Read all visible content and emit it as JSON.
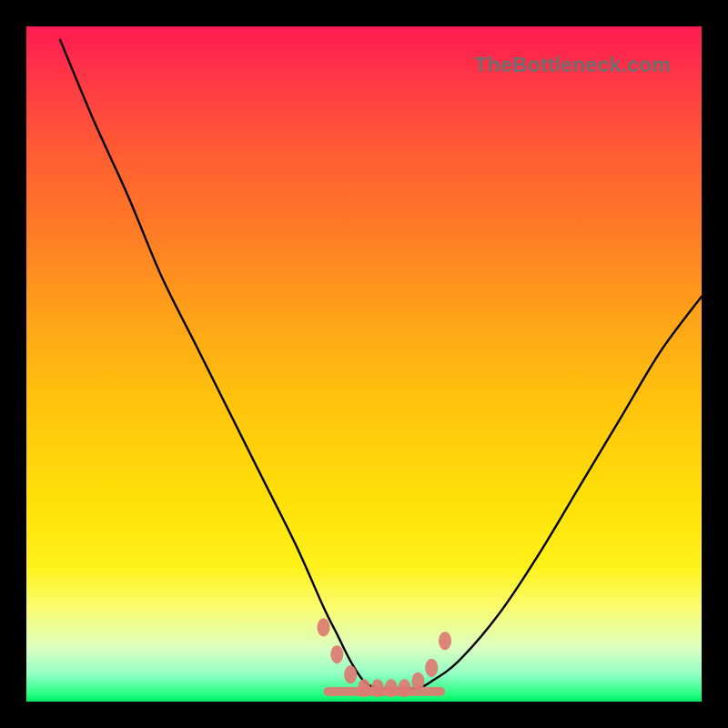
{
  "watermark": "TheBottleneck.com",
  "colors": {
    "frame": "#000000",
    "curve": "#000000",
    "marker": "#dd7b73",
    "gradient_top": "#ff1a54",
    "gradient_bottom": "#00e868"
  },
  "chart_data": {
    "type": "line",
    "title": "",
    "xlabel": "",
    "ylabel": "",
    "xlim": [
      0,
      100
    ],
    "ylim": [
      0,
      100
    ],
    "series": [
      {
        "name": "bottleneck-curve",
        "x": [
          5,
          10,
          15,
          20,
          25,
          30,
          35,
          40,
          44,
          46,
          48,
          50,
          52,
          54,
          56,
          58,
          60,
          64,
          70,
          76,
          82,
          88,
          94,
          100
        ],
        "values": [
          98,
          86,
          75,
          63,
          53,
          43,
          33,
          23,
          14,
          10,
          6,
          3,
          2,
          2,
          2,
          2,
          3,
          6,
          13,
          22,
          32,
          42,
          52,
          60
        ]
      }
    ],
    "markers": {
      "name": "highlight-dots",
      "x": [
        44,
        46,
        48,
        50,
        52,
        54,
        56,
        58,
        60,
        62
      ],
      "values": [
        11,
        7,
        4,
        2,
        2,
        2,
        2,
        3,
        5,
        9
      ]
    },
    "segment_bar": {
      "y": 1.5,
      "x_start": 44,
      "x_end": 62
    }
  }
}
